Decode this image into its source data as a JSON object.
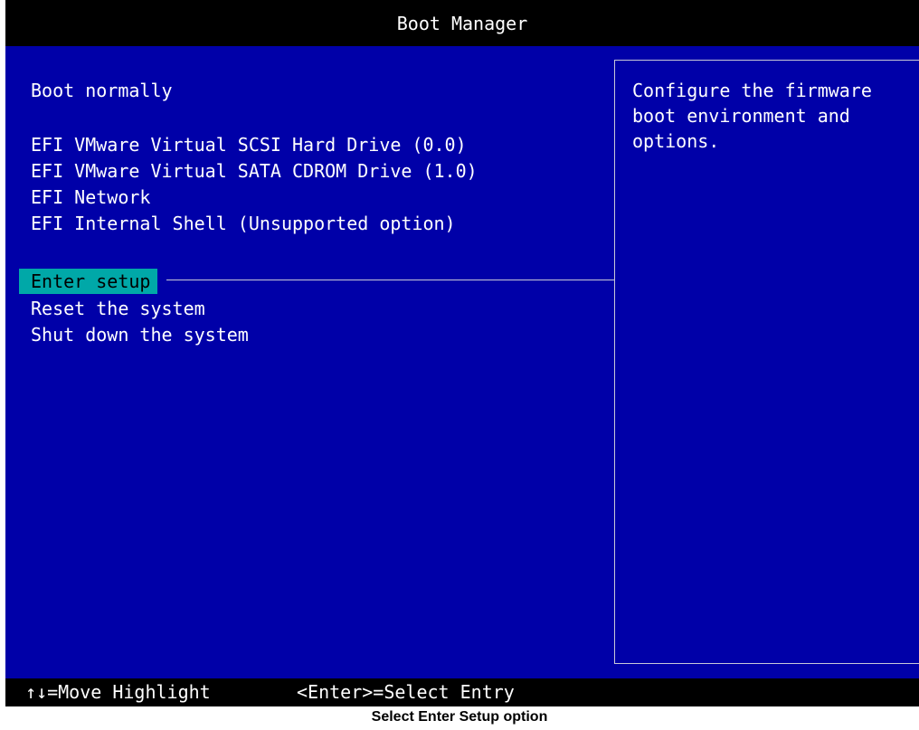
{
  "window": {
    "title": "Boot Manager"
  },
  "menu": {
    "items": [
      {
        "label": "Boot normally",
        "selected": false
      },
      {
        "label": "EFI VMware Virtual SCSI Hard Drive (0.0)",
        "selected": false
      },
      {
        "label": "EFI VMware Virtual SATA CDROM Drive (1.0)",
        "selected": false
      },
      {
        "label": "EFI Network",
        "selected": false
      },
      {
        "label": "EFI Internal Shell (Unsupported option)",
        "selected": false
      },
      {
        "label": "Enter setup",
        "selected": true
      },
      {
        "label": "Reset the system",
        "selected": false
      },
      {
        "label": "Shut down the system",
        "selected": false
      }
    ]
  },
  "help": {
    "text": "Configure the firmware\nboot environment and\noptions."
  },
  "footer": {
    "move_hint": "↑↓=Move Highlight",
    "select_hint": "<Enter>=Select Entry"
  },
  "caption": {
    "text": "Select Enter Setup option"
  },
  "colors": {
    "background": "#0000a8",
    "highlight": "#00a8a8",
    "bar": "#000000",
    "text": "#ffffff"
  }
}
